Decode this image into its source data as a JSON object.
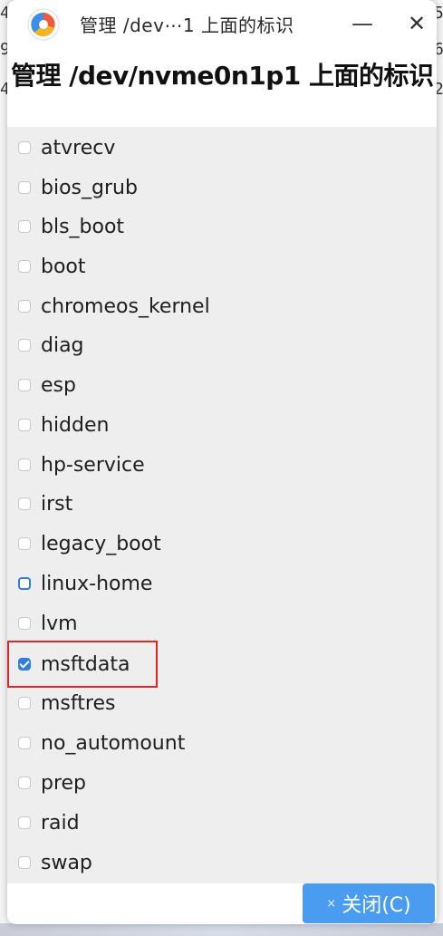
{
  "window": {
    "title": "管理 /dev⋯1 上面的标识",
    "minimize_glyph": "—",
    "close_glyph": "✕"
  },
  "heading": "管理 /dev/nvme0n1p1 上面的标识",
  "background_digits": {
    "left": [
      "4",
      "9",
      "4"
    ],
    "right": [
      "5",
      "6",
      "2"
    ]
  },
  "flags": [
    {
      "label": "atvrecv",
      "checked": false
    },
    {
      "label": "bios_grub",
      "checked": false
    },
    {
      "label": "bls_boot",
      "checked": false
    },
    {
      "label": "boot",
      "checked": false
    },
    {
      "label": "chromeos_kernel",
      "checked": false
    },
    {
      "label": "diag",
      "checked": false
    },
    {
      "label": "esp",
      "checked": false
    },
    {
      "label": "hidden",
      "checked": false
    },
    {
      "label": "hp-service",
      "checked": false
    },
    {
      "label": "irst",
      "checked": false
    },
    {
      "label": "legacy_boot",
      "checked": false
    },
    {
      "label": "linux-home",
      "checked": false,
      "focused": true
    },
    {
      "label": "lvm",
      "checked": false
    },
    {
      "label": "msftdata",
      "checked": true,
      "highlighted": true
    },
    {
      "label": "msftres",
      "checked": false
    },
    {
      "label": "no_automount",
      "checked": false
    },
    {
      "label": "prep",
      "checked": false
    },
    {
      "label": "raid",
      "checked": false
    },
    {
      "label": "swap",
      "checked": false
    }
  ],
  "footer": {
    "close_button_label": "关闭(C)",
    "close_button_glyph": "×"
  },
  "colors": {
    "accent": "#4a9cf0",
    "checkbox_checked": "#2f7de1",
    "highlight": "#e0252b"
  }
}
